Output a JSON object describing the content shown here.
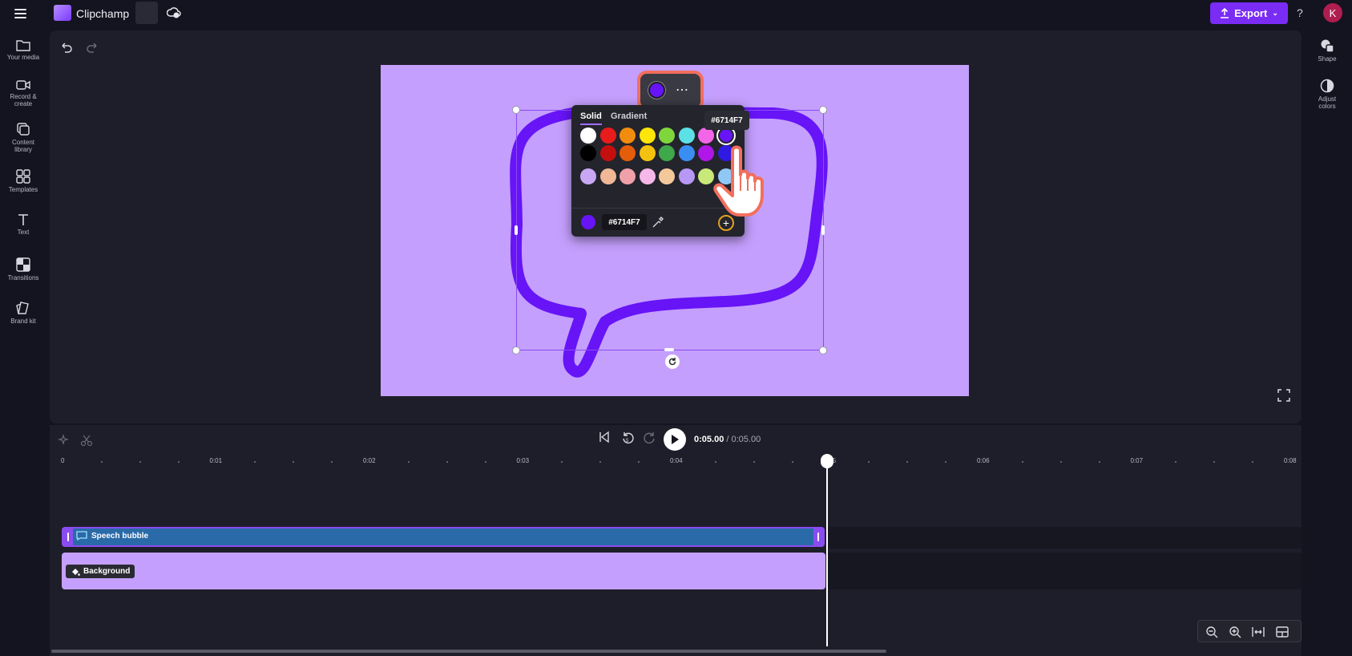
{
  "app": {
    "name": "Clipchamp",
    "export_label": "Export",
    "help": "?",
    "avatar_initial": "K"
  },
  "left_sidebar": {
    "items": [
      {
        "label": "Your media",
        "icon": "folder-icon"
      },
      {
        "label": "Record & create",
        "icon": "video-camera-icon"
      },
      {
        "label": "Content library",
        "icon": "content-library-icon"
      },
      {
        "label": "Templates",
        "icon": "templates-icon"
      },
      {
        "label": "Text",
        "icon": "text-icon"
      },
      {
        "label": "Transitions",
        "icon": "transitions-icon"
      },
      {
        "label": "Brand kit",
        "icon": "brand-kit-icon"
      }
    ]
  },
  "right_sidebar": {
    "items": [
      {
        "label": "Shape",
        "icon": "shape-icon"
      },
      {
        "label": "Adjust colors",
        "icon": "adjust-colors-icon"
      }
    ]
  },
  "color_picker": {
    "tabs": [
      "Solid",
      "Gradient"
    ],
    "active_tab": "Solid",
    "selected_color": "#6714F7",
    "hex_value": "#6714F7",
    "hex_tooltip": "#6714F7",
    "swatches": [
      [
        "#ffffff",
        "#e81c1c",
        "#f28c0f",
        "#ffe60a",
        "#7fd63c",
        "#5ce1e6",
        "#f466e8",
        "#6714f7"
      ],
      [
        "#000000",
        "#c40f0f",
        "#e35d0a",
        "#f2c20f",
        "#3fa84a",
        "#3a8ef2",
        "#b016e8",
        "#2e1ae0"
      ],
      [
        "#c8a8f5",
        "#f0b896",
        "#f0a0a8",
        "#f5b8e8",
        "#f5c89a",
        "#b898f5",
        "#c8e878",
        "#90c8f5"
      ]
    ]
  },
  "playback": {
    "current_time": "0:05.00",
    "total_time": "/ 0:05.00"
  },
  "timeline": {
    "ticks": [
      "0",
      "0:01",
      "0:02",
      "0:03",
      "0:04",
      "0:05",
      "0:06",
      "0:07",
      "0:08"
    ],
    "tracks": [
      {
        "label": "Speech bubble",
        "icon": "speech-bubble-icon"
      },
      {
        "label": "Background",
        "icon": "paint-bucket-icon"
      }
    ]
  },
  "colors": {
    "accent": "#7a2cf5",
    "canvas_bg": "#c49ffd",
    "shape_stroke": "#6714f7",
    "highlight": "#f26f5d"
  }
}
